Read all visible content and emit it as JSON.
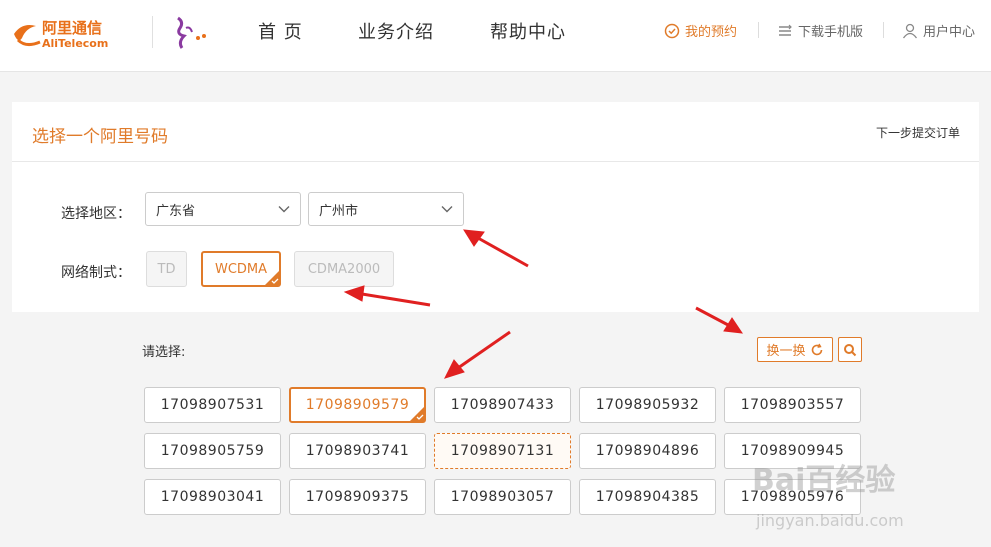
{
  "header": {
    "brand_cn": "阿里通信",
    "brand_en": "AliTelecom",
    "nav": [
      "首 页",
      "业务介绍",
      "帮助中心"
    ],
    "links": {
      "my_booking": "我的预约",
      "download_app": "下载手机版",
      "user_center": "用户中心"
    }
  },
  "card": {
    "title": "选择一个阿里号码",
    "next_step": "下一步提交订单",
    "region_label": "选择地区：",
    "province": "广东省",
    "city": "广州市",
    "network_label": "网络制式：",
    "networks": [
      "TD",
      "WCDMA",
      "CDMA2000"
    ],
    "selected_network": "WCDMA"
  },
  "numbers": {
    "choose_label": "请选择:",
    "refresh_label": "换一换",
    "list": [
      "17098907531",
      "17098909579",
      "17098907433",
      "17098905932",
      "17098903557",
      "17098905759",
      "17098903741",
      "17098907131",
      "17098904896",
      "17098909945",
      "17098903041",
      "17098909375",
      "17098903057",
      "17098904385",
      "17098905976"
    ],
    "selected": "17098909579",
    "hovered": "17098907131"
  },
  "watermark": {
    "text": "Bai百经验",
    "url": "jingyan.baidu.com"
  },
  "colors": {
    "accent": "#e07b2a",
    "arrow": "#e02020"
  }
}
